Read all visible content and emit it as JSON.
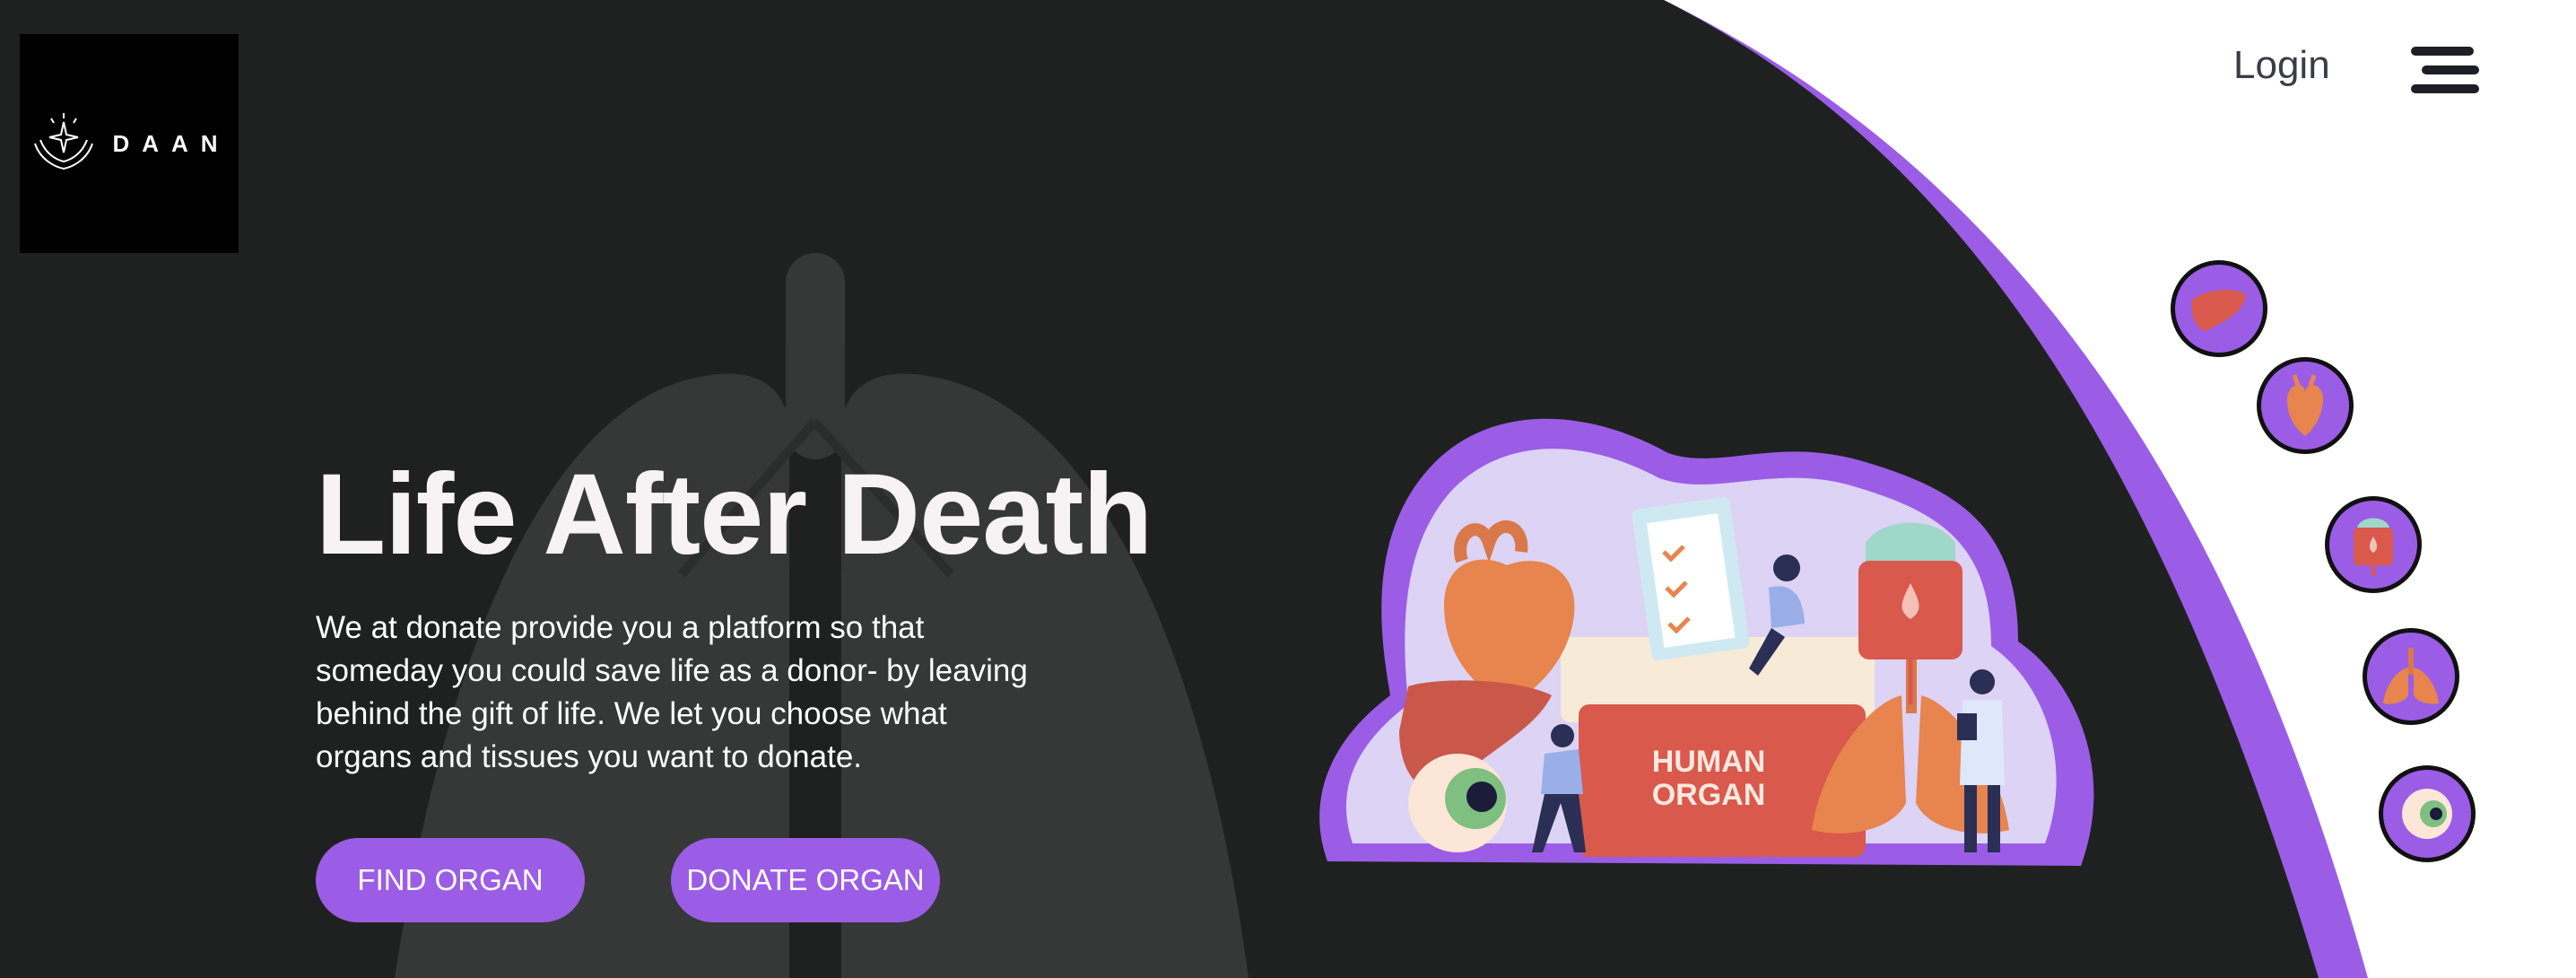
{
  "brand": {
    "name": "DAAN",
    "logo_icon": "hands-sparkle-icon"
  },
  "nav": {
    "login_label": "Login",
    "menu_icon": "hamburger-menu-icon"
  },
  "hero": {
    "title": "Life After Death",
    "description": "We at donate provide you a platform so that someday you could save life as a donor- by leaving behind the gift of life. We let you choose what organs and tissues you want to donate."
  },
  "buttons": {
    "find_organ": "FIND ORGAN",
    "donate_organ": "DONATE ORGAN"
  },
  "illustration": {
    "box_label_line1": "HUMAN",
    "box_label_line2": "ORGAN"
  },
  "organ_icons": [
    "liver-icon",
    "heart-icon",
    "blood-bag-icon",
    "lungs-icon",
    "eye-icon"
  ],
  "colors": {
    "dark_bg": "#1f2120",
    "accent_purple": "#9b5de5",
    "title_white": "#f7f2f4",
    "logo_bg": "#000000"
  }
}
